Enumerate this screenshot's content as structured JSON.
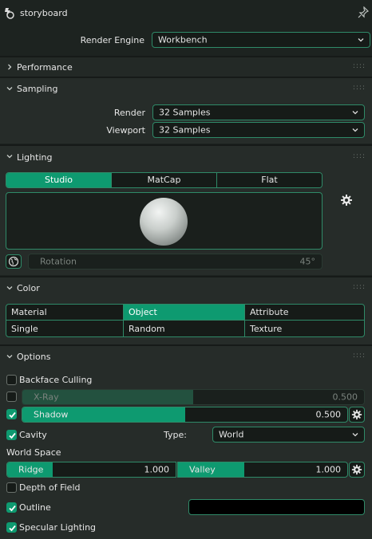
{
  "title": "storyboard",
  "render_engine": {
    "label": "Render Engine",
    "value": "Workbench"
  },
  "sections": {
    "performance": "Performance",
    "sampling": "Sampling",
    "lighting": "Lighting",
    "color": "Color",
    "options": "Options"
  },
  "sampling": {
    "render_label": "Render",
    "render_value": "32 Samples",
    "viewport_label": "Viewport",
    "viewport_value": "32 Samples"
  },
  "lighting": {
    "modes": [
      "Studio",
      "MatCap",
      "Flat"
    ],
    "selected_mode": "Studio",
    "rotation_label": "Rotation",
    "rotation_value": "45°"
  },
  "color": {
    "options": [
      "Material",
      "Object",
      "Attribute",
      "Single",
      "Random",
      "Texture"
    ],
    "selected": "Object"
  },
  "options": {
    "backface_culling": {
      "label": "Backface Culling",
      "checked": false
    },
    "xray": {
      "label": "X-Ray",
      "value": "0.500",
      "fraction": 0.5,
      "checked": false
    },
    "shadow": {
      "label": "Shadow",
      "value": "0.500",
      "fraction": 0.5,
      "checked": true
    },
    "cavity": {
      "label": "Cavity",
      "checked": true
    },
    "type_label": "Type:",
    "type_value": "World",
    "world_space_label": "World Space",
    "ridge": {
      "label": "Ridge",
      "value": "1.000",
      "fraction": 0.25
    },
    "valley": {
      "label": "Valley",
      "value": "1.000",
      "fraction": 0.25
    },
    "depth_of_field": {
      "label": "Depth of Field",
      "checked": false
    },
    "outline": {
      "label": "Outline",
      "checked": true,
      "color": "#000000"
    },
    "specular_lighting": {
      "label": "Specular Lighting",
      "checked": true
    }
  },
  "colors": {
    "accent": "#0e9a70",
    "border": "#2f8a68",
    "field": "#161b18",
    "panel": "#262c29",
    "header": "#1d2320"
  },
  "icons": [
    "render-properties-icon",
    "pin-icon",
    "chevron-right-icon",
    "chevron-down-icon",
    "gear-icon",
    "world-icon",
    "checkmark-icon"
  ]
}
